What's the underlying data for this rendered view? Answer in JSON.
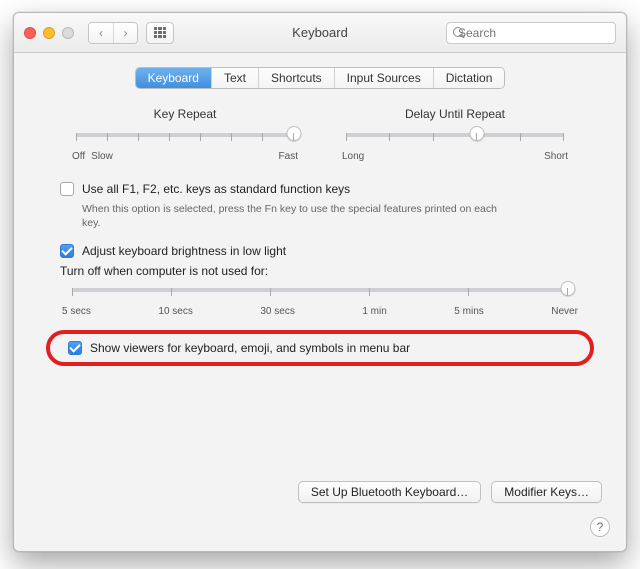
{
  "window": {
    "title": "Keyboard"
  },
  "search": {
    "placeholder": "Search"
  },
  "tabs": [
    {
      "label": "Keyboard",
      "active": true
    },
    {
      "label": "Text"
    },
    {
      "label": "Shortcuts"
    },
    {
      "label": "Input Sources"
    },
    {
      "label": "Dictation"
    }
  ],
  "sliders": {
    "keyRepeat": {
      "label": "Key Repeat",
      "leftOff": "Off",
      "left": "Slow",
      "right": "Fast",
      "ticks": 8,
      "valueIndex": 7
    },
    "delay": {
      "label": "Delay Until Repeat",
      "left": "Long",
      "right": "Short",
      "ticks": 6,
      "valueIndex": 3
    }
  },
  "options": {
    "fnKeys": {
      "checked": false,
      "label": "Use all F1, F2, etc. keys as standard function keys",
      "note": "When this option is selected, press the Fn key to use the special features printed on each key."
    },
    "brightness": {
      "checked": true,
      "label": "Adjust keyboard brightness in low light"
    },
    "turnoff": {
      "label": "Turn off when computer is not used for:",
      "marks": [
        "5 secs",
        "10 secs",
        "30 secs",
        "1 min",
        "5 mins",
        "Never"
      ],
      "valueIndex": 5
    },
    "viewers": {
      "checked": true,
      "label": "Show viewers for keyboard, emoji, and symbols in menu bar",
      "highlighted": true
    }
  },
  "buttons": {
    "bluetooth": "Set Up Bluetooth Keyboard…",
    "modifier": "Modifier Keys…"
  },
  "help": "?"
}
